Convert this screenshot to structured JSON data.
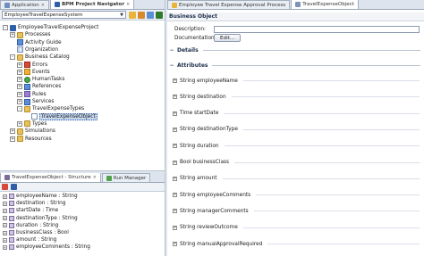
{
  "navigator": {
    "tabs": [
      {
        "label": "Application",
        "active": false
      },
      {
        "label": "BPM Project Navigator",
        "active": true
      }
    ],
    "system_combo": "EmployeeTravelExpenseSystem",
    "tree": [
      {
        "label": "EmployeeTravelExpenseProject",
        "indent": 0,
        "expander": "-",
        "icon": "project"
      },
      {
        "label": "Processes",
        "indent": 1,
        "expander": "+",
        "icon": "folder"
      },
      {
        "label": "Activity Guide",
        "indent": 1,
        "expander": "",
        "icon": "blue"
      },
      {
        "label": "Organization",
        "indent": 1,
        "expander": "",
        "icon": "grid"
      },
      {
        "label": "Business Catalog",
        "indent": 1,
        "expander": "-",
        "icon": "folder"
      },
      {
        "label": "Errors",
        "indent": 2,
        "expander": "+",
        "icon": "red"
      },
      {
        "label": "Events",
        "indent": 2,
        "expander": "+",
        "icon": "orange"
      },
      {
        "label": "HumanTasks",
        "indent": 2,
        "expander": "+",
        "icon": "green"
      },
      {
        "label": "References",
        "indent": 2,
        "expander": "+",
        "icon": "blue"
      },
      {
        "label": "Rules",
        "indent": 2,
        "expander": "+",
        "icon": "purple"
      },
      {
        "label": "Services",
        "indent": 2,
        "expander": "+",
        "icon": "blue"
      },
      {
        "label": "TravelExpenseTypes",
        "indent": 2,
        "expander": "-",
        "icon": "folder"
      },
      {
        "label": "TravelExpenseObject",
        "indent": 3,
        "expander": "",
        "icon": "doc",
        "selected": true
      },
      {
        "label": "Types",
        "indent": 2,
        "expander": "+",
        "icon": "folder"
      },
      {
        "label": "Simulations",
        "indent": 1,
        "expander": "+",
        "icon": "folder"
      },
      {
        "label": "Resources",
        "indent": 1,
        "expander": "+",
        "icon": "folder"
      }
    ]
  },
  "structure": {
    "tabs": [
      {
        "label": "TravelExpenseObject - Structure",
        "active": true
      },
      {
        "label": "Run Manager",
        "active": false
      }
    ],
    "items": [
      "employeeName : String",
      "destination : String",
      "startDate : Time",
      "destinationType : String",
      "duration : String",
      "businessClass : Bool",
      "amount : String",
      "employeeComments : String"
    ]
  },
  "editor": {
    "tabs": [
      {
        "label": "Employee Travel Expense Approval Process",
        "active": false
      },
      {
        "label": "TravelExpenseObject",
        "active": true
      }
    ],
    "business_object_title": "Business Object",
    "description_label": "Description:",
    "description_value": "",
    "documentation_label": "Documentation:",
    "edit_button": "Edit...",
    "details_section": "Details",
    "attributes_section": "Attributes",
    "attributes": [
      "String employeeName",
      "String destination",
      "Time startDate",
      "String destinationType",
      "String duration",
      "Bool businessClass",
      "String amount",
      "String employeeComments",
      "String managerComments",
      "String reviewOutcome",
      "String manualApprovalRequired"
    ]
  },
  "colors": {
    "chrome": "#dde4ee",
    "selection": "#c7d8ef",
    "section_text": "#1a2c48"
  }
}
